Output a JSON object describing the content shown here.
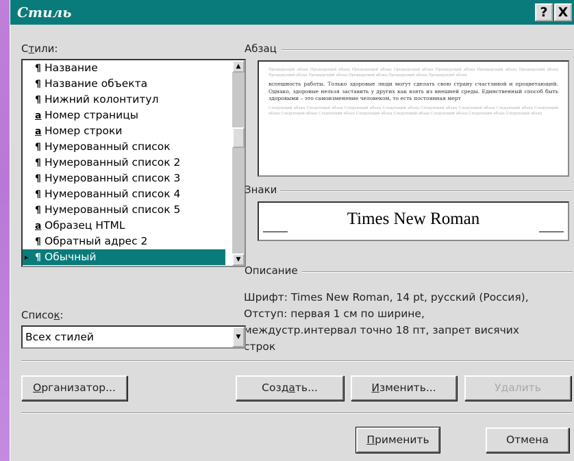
{
  "dialog": {
    "title": "Стиль",
    "help_button": "?",
    "close_button": "X"
  },
  "styles": {
    "label_pre": "С",
    "label_ul": "т",
    "label_post": "или:",
    "items": [
      {
        "glyph": "¶",
        "label": "Название"
      },
      {
        "glyph": "¶",
        "label": "Название объекта"
      },
      {
        "glyph": "¶",
        "label": "Нижний колонтитул"
      },
      {
        "glyph": "a",
        "label": "Номер страницы"
      },
      {
        "glyph": "a",
        "label": "Номер строки"
      },
      {
        "glyph": "¶",
        "label": "Нумерованный список"
      },
      {
        "glyph": "¶",
        "label": "Нумерованный список 2"
      },
      {
        "glyph": "¶",
        "label": "Нумерованный список 3"
      },
      {
        "glyph": "¶",
        "label": "Нумерованный список 4"
      },
      {
        "glyph": "¶",
        "label": "Нумерованный список 5"
      },
      {
        "glyph": "a",
        "label": "Образец HTML"
      },
      {
        "glyph": "¶",
        "label": "Обратный адрес 2"
      },
      {
        "glyph": "¶",
        "label": "Обычный"
      }
    ],
    "selected_marker": "▸"
  },
  "paragraph": {
    "label": "Абзац",
    "preview_prev": "Предыдущий абзац Предыдущий абзац Предыдущий абзац Предыдущий абзац Предыдущий абзац Предыдущий абзац Предыдущий абзац Предыдущий абзац Предыдущий абзац Предыдущий абзац Предыдущий абзац Предыдущий абзац",
    "preview_main": "вспешность работы. Только здоровые люди могут сделать свою страну счастливой и процветающей. Однако, здоровые нельзя заставить у других как взять из внешней среды. Единственный способ быть здоровыми – это самоизменение человеком, то есть постоянная мерт",
    "preview_next": "Следующий абзац Следующий абзац Следующий абзац Следующий абзац Следующий абзац Следующий абзац Следующий абзац Следующий абзац Следующий абзац Следующий абзац Следующий абзац Следующий абзац Следующий абзац Следующий абзац Следующий абзац"
  },
  "font": {
    "label": "Знаки",
    "sample": "Times New Roman"
  },
  "description": {
    "label": "Описание",
    "line1": "Шрифт: Times New Roman, 14 pt, русский (Россия),",
    "line2": "Отступ:  первая  1 см по ширине,",
    "line3": "междустр.интервал точно 18 пт, запрет висячих",
    "line4": "строк"
  },
  "list_filter": {
    "label_pre": "Списо",
    "label_ul": "к",
    "label_post": ":",
    "value": "Всех стилей"
  },
  "buttons": {
    "organizer_ul": "О",
    "organizer_rest": "рганизатор...",
    "create_pre": "Созд",
    "create_ul": "а",
    "create_post": "ть...",
    "modify_ul": "И",
    "modify_rest": "зменить...",
    "delete": "Удалить",
    "apply_ul": "П",
    "apply_rest": "рименить",
    "cancel": "Отмена"
  }
}
